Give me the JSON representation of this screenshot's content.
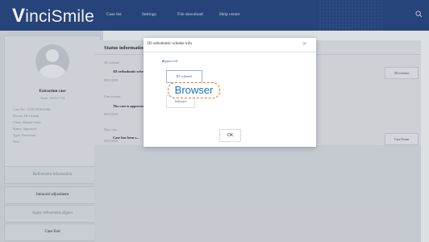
{
  "header": {
    "logo": "VinciSmile",
    "nav": [
      "Case list",
      "Settings",
      "File download",
      "Help center"
    ],
    "search_icon": "search-icon"
  },
  "sidebar": {
    "patient_name": "Extraction case",
    "patient_id": "Time: 2015-7-13",
    "info": [
      "Case No.: 10301302030401",
      "Doctor: Dr. Grimm",
      "Clinic: Dental Clinic",
      "Status: Approved",
      "Type: Extraction",
      "Note: ..."
    ],
    "buttons": [
      "Refinement Information",
      "Intraoral adjustment",
      "Apply refinement aligner",
      "Case End"
    ]
  },
  "main": {
    "title": "Status information",
    "sections": [
      {
        "label": "3D scheme",
        "entry": "3D orthodontic scheme",
        "date": "09/15/2019",
        "button": "3D scheme"
      },
      {
        "label": "Case review",
        "entry": "The case is approved",
        "date": "09/15/2019",
        "button": ""
      },
      {
        "label": "New case",
        "entry": "Case has been s...",
        "date": "09/15/2019",
        "button": "Case Form"
      }
    ]
  },
  "modal": {
    "title": "3D orthodontic scheme info",
    "close": "×",
    "status": "Approved",
    "option_scheme": "3D scheme1",
    "option_browser": "Browser",
    "option_software": "Software",
    "ok": "OK"
  }
}
